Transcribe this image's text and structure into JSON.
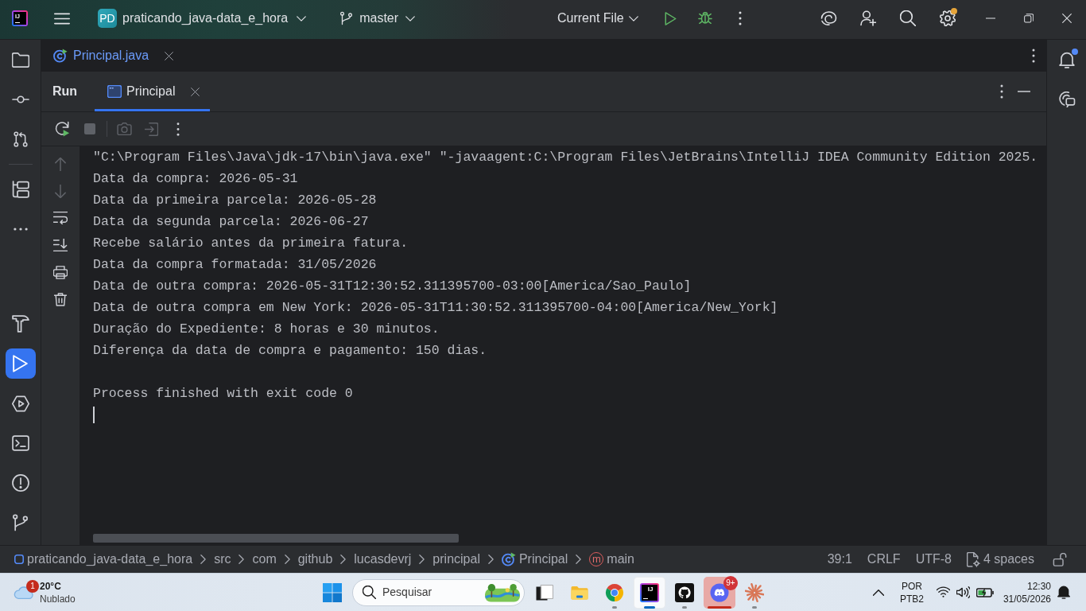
{
  "title_bar": {
    "logo_text": "IJ",
    "project_badge": "PD",
    "project_name": "praticando_java-data_e_hora",
    "branch": "master",
    "run_configuration": "Current File",
    "settings_update": true
  },
  "tool_strip": {
    "top": [
      {
        "selected": false
      },
      {
        "selected": false
      },
      {
        "selected": false
      },
      {
        "selected": false
      },
      {
        "selected": false
      }
    ],
    "bottom": [
      {
        "selected": false
      },
      {
        "selected": true
      },
      {
        "selected": false
      },
      {
        "selected": false
      },
      {
        "selected": false
      },
      {
        "selected": false
      }
    ]
  },
  "editor_tabs": [
    {
      "label": "Principal.java",
      "modified": true
    }
  ],
  "run_panel": {
    "title": "Run",
    "tabs": [
      {
        "label": "Principal",
        "selected": true
      }
    ],
    "toolbar": [
      {
        "disabled": false
      },
      {
        "disabled": true
      },
      {
        "disabled": true
      },
      {
        "disabled": true
      },
      {
        "disabled": false
      }
    ],
    "side_actions": [
      {
        "disabled": true
      },
      {
        "disabled": true
      },
      {
        "disabled": false
      },
      {
        "disabled": false
      },
      {
        "disabled": false
      },
      {
        "disabled": false
      }
    ],
    "console": {
      "lines": [
        "\"C:\\Program Files\\Java\\jdk-17\\bin\\java.exe\" \"-javaagent:C:\\Program Files\\JetBrains\\IntelliJ IDEA Community Edition 2025.",
        "Data da compra: 2026-05-31",
        "Data da primeira parcela: 2026-05-28",
        "Data da segunda parcela: 2026-06-27",
        "Recebe salário antes da primeira fatura.",
        "Data da compra formatada: 31/05/2026",
        "Data de outra compra: 2026-05-31T12:30:52.311395700-03:00[America/Sao_Paulo]",
        "Data de outra compra em New York: 2026-05-31T11:30:52.311395700-04:00[America/New_York]",
        "Duração do Expediente: 8 horas e 30 minutos.",
        "Diferença da data de compra e pagamento: 150 dias."
      ],
      "exit_message": "Process finished with exit code 0"
    }
  },
  "notifications": {
    "unread": true
  },
  "status_bar": {
    "breadcrumbs": [
      {
        "kind": "module",
        "text": "praticando_java-data_e_hora"
      },
      {
        "kind": "folder",
        "text": "src"
      },
      {
        "kind": "folder",
        "text": "com"
      },
      {
        "kind": "folder",
        "text": "github"
      },
      {
        "kind": "folder",
        "text": "lucasdevrj"
      },
      {
        "kind": "folder",
        "text": "principal"
      },
      {
        "kind": "class",
        "text": "Principal"
      },
      {
        "kind": "method",
        "text": "main",
        "icon_letter": "m"
      }
    ],
    "position": "39:1",
    "line_separator": "CRLF",
    "encoding": "UTF-8",
    "indent": "4 spaces"
  },
  "taskbar": {
    "weather": {
      "alert_count": "1",
      "temperature": "20°C",
      "condition": "Nublado"
    },
    "search": {
      "placeholder": "Pesquisar"
    },
    "apps": [
      {
        "running": false,
        "selected": false,
        "attention": false
      },
      {
        "running": false,
        "selected": false,
        "attention": false
      },
      {
        "running": true,
        "selected": false,
        "attention": false
      },
      {
        "running": true,
        "selected": true,
        "attention": false,
        "logo_text": "IJ"
      },
      {
        "running": true,
        "selected": false,
        "attention": false
      },
      {
        "running": true,
        "selected": false,
        "attention": true,
        "badge": "9+"
      },
      {
        "running": true,
        "selected": false,
        "attention": false
      }
    ],
    "tray": {
      "input_language": "POR",
      "keyboard_layout": "PTB2",
      "time": "12:30",
      "date": "31/05/2026"
    }
  }
}
